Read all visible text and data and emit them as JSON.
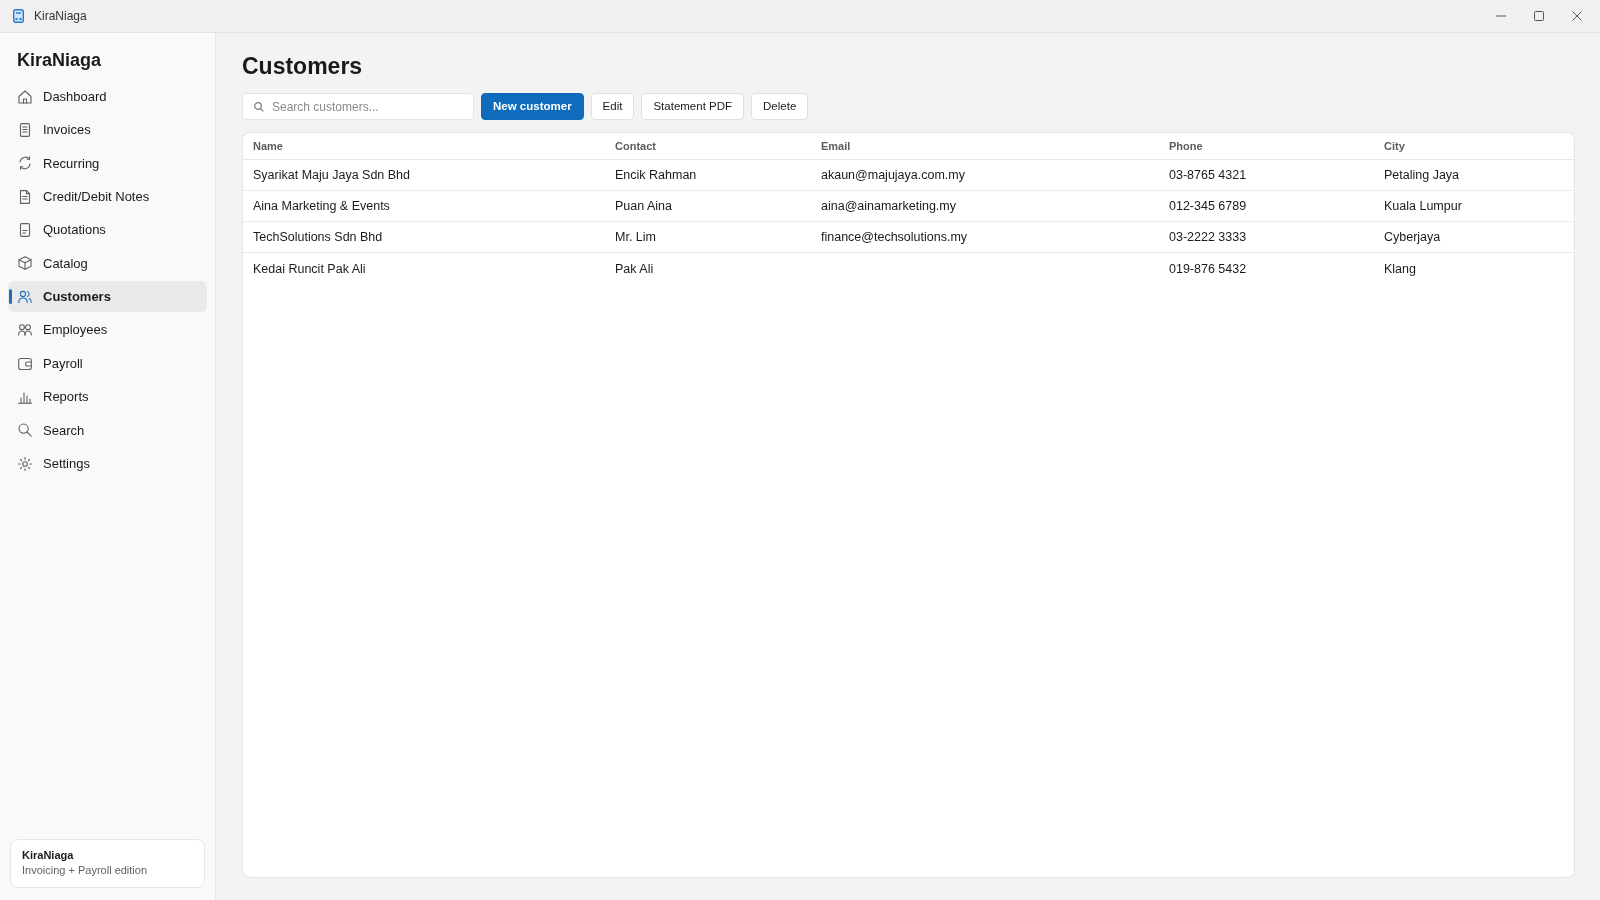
{
  "window": {
    "title": "KiraNiaga"
  },
  "sidebar": {
    "brand": "KiraNiaga",
    "items": [
      {
        "label": "Dashboard",
        "selected": false
      },
      {
        "label": "Invoices",
        "selected": false
      },
      {
        "label": "Recurring",
        "selected": false
      },
      {
        "label": "Credit/Debit Notes",
        "selected": false
      },
      {
        "label": "Quotations",
        "selected": false
      },
      {
        "label": "Catalog",
        "selected": false
      },
      {
        "label": "Customers",
        "selected": true
      },
      {
        "label": "Employees",
        "selected": false
      },
      {
        "label": "Payroll",
        "selected": false
      },
      {
        "label": "Reports",
        "selected": false
      },
      {
        "label": "Search",
        "selected": false
      },
      {
        "label": "Settings",
        "selected": false
      }
    ],
    "footer": {
      "title": "KiraNiaga",
      "subtitle": "Invoicing + Payroll edition"
    }
  },
  "main": {
    "title": "Customers",
    "search": {
      "placeholder": "Search customers..."
    },
    "actions": [
      {
        "label": "New customer",
        "kind": "primary"
      },
      {
        "label": "Edit",
        "kind": "secondary"
      },
      {
        "label": "Statement PDF",
        "kind": "secondary"
      },
      {
        "label": "Delete",
        "kind": "secondary"
      }
    ],
    "table": {
      "columns": [
        "Name",
        "Contact",
        "Email",
        "Phone",
        "City"
      ],
      "rows": [
        {
          "name": "Syarikat Maju Jaya Sdn Bhd",
          "contact": "Encik Rahman",
          "email": "akaun@majujaya.com.my",
          "phone": "03-8765 4321",
          "city": "Petaling Jaya"
        },
        {
          "name": "Aina Marketing & Events",
          "contact": "Puan Aina",
          "email": "aina@ainamarketing.my",
          "phone": "012-345 6789",
          "city": "Kuala Lumpur"
        },
        {
          "name": "TechSolutions Sdn Bhd",
          "contact": "Mr. Lim",
          "email": "finance@techsolutions.my",
          "phone": "03-2222 3333",
          "city": "Cyberjaya"
        },
        {
          "name": "Kedai Runcit Pak Ali",
          "contact": "Pak Ali",
          "phone": "019-876 5432",
          "city": "Klang"
        }
      ]
    }
  }
}
